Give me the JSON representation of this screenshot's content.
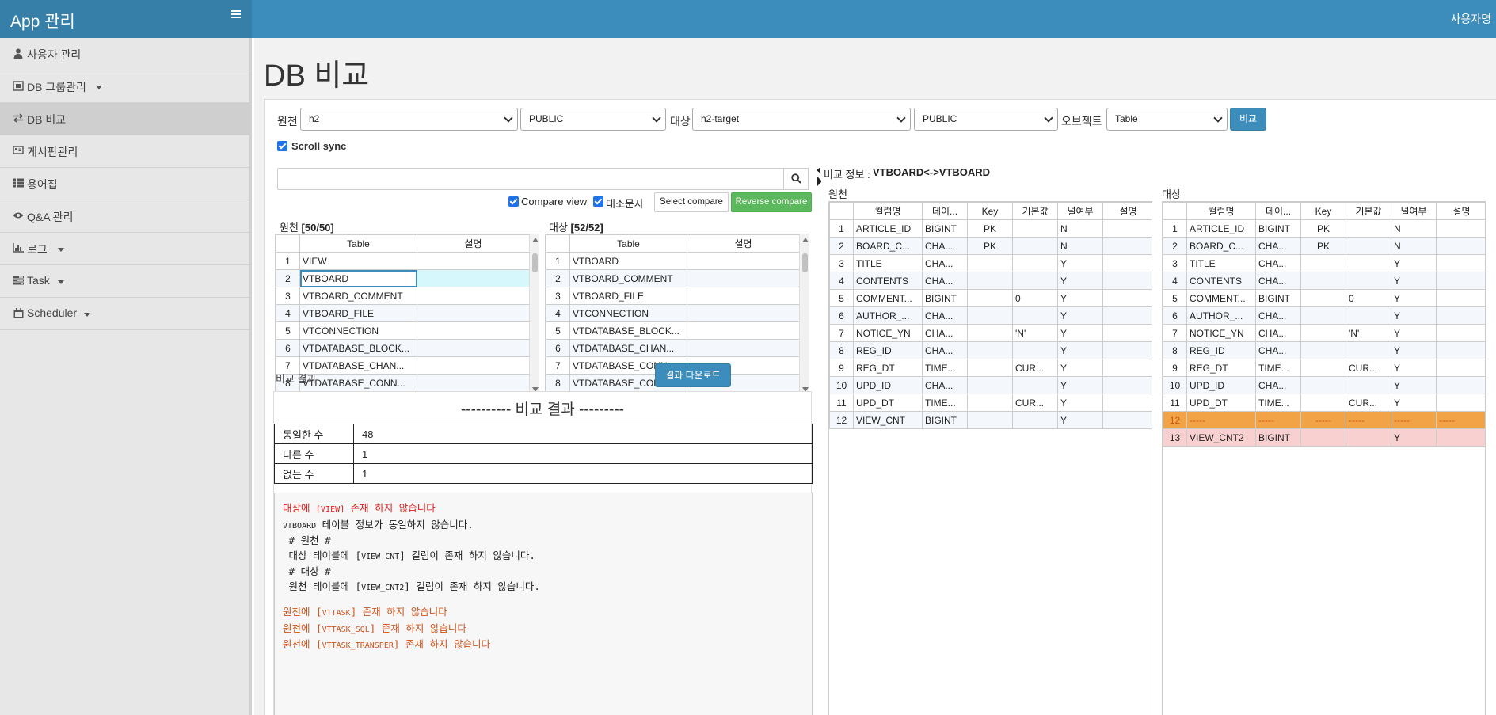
{
  "app": {
    "title": "App 관리",
    "user": "사용자명"
  },
  "sidebar": {
    "items": [
      {
        "label": "사용자 관리",
        "icon": "user-icon"
      },
      {
        "label": "DB 그룹관리",
        "icon": "db-group-icon"
      },
      {
        "label": "DB 비교",
        "icon": "exchange-icon"
      },
      {
        "label": "게시판관리",
        "icon": "board-icon"
      },
      {
        "label": "용어집",
        "icon": "list-icon"
      },
      {
        "label": "Q&A 관리",
        "icon": "eye-icon"
      },
      {
        "label": "로그",
        "icon": "bar-chart-icon"
      },
      {
        "label": "Task",
        "icon": "tasks-icon"
      },
      {
        "label": "Scheduler",
        "icon": "calendar-icon"
      }
    ]
  },
  "page": {
    "title": "DB 비교"
  },
  "controls": {
    "source_label": "원천",
    "source_db": "h2",
    "source_schema": "PUBLIC",
    "target_label": "대상",
    "target_db": "h2-target",
    "target_schema": "PUBLIC",
    "object_label": "오브젝트",
    "object_type": "Table",
    "compare_button": "비교",
    "scroll_sync": "Scroll sync"
  },
  "table_list": {
    "search_value": "",
    "compare_view": "Compare view",
    "case_sensitive": "대소문자",
    "select_compare": "Select compare",
    "reverse_compare": "Reverse compare",
    "source_title": "원천",
    "source_count": "[50/50]",
    "target_title": "대상",
    "target_count": "[52/52]",
    "headers": [
      "Table",
      "설명"
    ],
    "source_rows": [
      "VIEW",
      "VTBOARD",
      "VTBOARD_COMMENT",
      "VTBOARD_FILE",
      "VTCONNECTION",
      "VTDATABASE_BLOCK...",
      "VTDATABASE_CHAN...",
      "VTDATABASE_CONN..."
    ],
    "target_rows": [
      "VTBOARD",
      "VTBOARD_COMMENT",
      "VTBOARD_FILE",
      "VTCONNECTION",
      "VTDATABASE_BLOCK...",
      "VTDATABASE_CHAN...",
      "VTDATABASE_CONN...",
      "VTDATABASE_CONN..."
    ]
  },
  "result": {
    "label": "비교 결과",
    "download_button": "결과 다운로드",
    "heading": "---------- 비교 결과 ---------",
    "summary": [
      {
        "label": "동일한 수",
        "value": "48"
      },
      {
        "label": "다른 수",
        "value": "1"
      },
      {
        "label": "없는 수",
        "value": "1"
      }
    ],
    "messages": {
      "m1a": "대상에 ",
      "m1b": "[VIEW]",
      "m1c": " 존재 하지 않습니다",
      "m2a": "VTBOARD",
      "m2b": " 테이블 정보가 동일하지 않습니다.",
      "m3": " # 원천 #",
      "m4a": " 대상 테이블에 [",
      "m4b": "VIEW_CNT",
      "m4c": "] 컬럼이 존재 하지 않습니다.",
      "m5": " # 대상 #",
      "m6a": " 원천 테이블에 [",
      "m6b": "VIEW_CNT2",
      "m6c": "] 컬럼이 존재 하지 않습니다.",
      "m7a": "원천에 [",
      "m7b": "VTTASK",
      "m7c": "] 존재 하지 않습니다",
      "m8a": "원천에 [",
      "m8b": "VTTASK_SQL",
      "m8c": "] 존재 하지 않습니다",
      "m9a": "원천에 [",
      "m9b": "VTTASK_TRANSPER",
      "m9c": "] 존재 하지 않습니다"
    }
  },
  "compare_info": {
    "label": "비교 정보 :",
    "value": "VTBOARD<->VTBOARD",
    "source_title": "원천",
    "target_title": "대상",
    "headers": [
      "컬럼명",
      "데이...",
      "Key",
      "기본값",
      "널여부",
      "설명"
    ],
    "source_rows": [
      [
        "1",
        "ARTICLE_ID",
        "BIGINT",
        "PK",
        "",
        "N",
        ""
      ],
      [
        "2",
        "BOARD_C...",
        "CHA...",
        "PK",
        "",
        "N",
        ""
      ],
      [
        "3",
        "TITLE",
        "CHA...",
        "",
        "",
        "Y",
        ""
      ],
      [
        "4",
        "CONTENTS",
        "CHA...",
        "",
        "",
        "Y",
        ""
      ],
      [
        "5",
        "COMMENT...",
        "BIGINT",
        "",
        "0",
        "Y",
        ""
      ],
      [
        "6",
        "AUTHOR_...",
        "CHA...",
        "",
        "",
        "Y",
        ""
      ],
      [
        "7",
        "NOTICE_YN",
        "CHA...",
        "",
        "'N'",
        "Y",
        ""
      ],
      [
        "8",
        "REG_ID",
        "CHA...",
        "",
        "",
        "Y",
        ""
      ],
      [
        "9",
        "REG_DT",
        "TIME...",
        "",
        "CUR...",
        "Y",
        ""
      ],
      [
        "10",
        "UPD_ID",
        "CHA...",
        "",
        "",
        "Y",
        ""
      ],
      [
        "11",
        "UPD_DT",
        "TIME...",
        "",
        "CUR...",
        "Y",
        ""
      ],
      [
        "12",
        "VIEW_CNT",
        "BIGINT",
        "",
        "",
        "Y",
        ""
      ]
    ],
    "target_rows": [
      [
        "1",
        "ARTICLE_ID",
        "BIGINT",
        "PK",
        "",
        "N",
        ""
      ],
      [
        "2",
        "BOARD_C...",
        "CHA...",
        "PK",
        "",
        "N",
        ""
      ],
      [
        "3",
        "TITLE",
        "CHA...",
        "",
        "",
        "Y",
        ""
      ],
      [
        "4",
        "CONTENTS",
        "CHA...",
        "",
        "",
        "Y",
        ""
      ],
      [
        "5",
        "COMMENT...",
        "BIGINT",
        "",
        "0",
        "Y",
        ""
      ],
      [
        "6",
        "AUTHOR_...",
        "CHA...",
        "",
        "",
        "Y",
        ""
      ],
      [
        "7",
        "NOTICE_YN",
        "CHA...",
        "",
        "'N'",
        "Y",
        ""
      ],
      [
        "8",
        "REG_ID",
        "CHA...",
        "",
        "",
        "Y",
        ""
      ],
      [
        "9",
        "REG_DT",
        "TIME...",
        "",
        "CUR...",
        "Y",
        ""
      ],
      [
        "10",
        "UPD_ID",
        "CHA...",
        "",
        "",
        "Y",
        ""
      ],
      [
        "11",
        "UPD_DT",
        "TIME...",
        "",
        "CUR...",
        "Y",
        ""
      ],
      [
        "12",
        "-----",
        "-----",
        "-----",
        "-----",
        "-----",
        "-----"
      ],
      [
        "13",
        "VIEW_CNT2",
        "BIGINT",
        "",
        "",
        "Y",
        ""
      ]
    ]
  }
}
